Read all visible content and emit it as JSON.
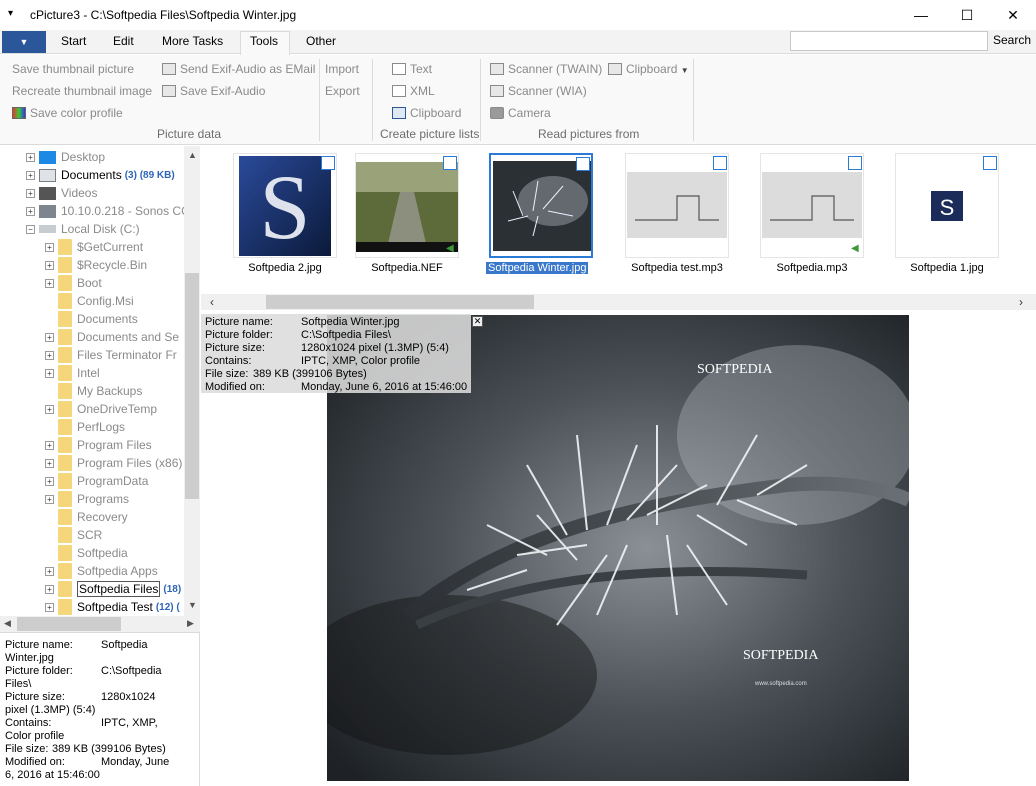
{
  "window": {
    "title": "cPicture3 - C:\\Softpedia Files\\Softpedia Winter.jpg",
    "quick_access": "▾",
    "minimize": "—",
    "maximize": "☐",
    "close": "✕"
  },
  "tabs": [
    "Start",
    "Edit",
    "More Tasks",
    "Tools",
    "Other"
  ],
  "active_tab": "Tools",
  "search": {
    "label": "Search",
    "value": ""
  },
  "ribbon": {
    "picture_data": {
      "label": "Picture data",
      "items": [
        "Save thumbnail picture",
        "Recreate thumbnail image",
        "Save color profile",
        "Send Exif-Audio as EMail",
        "Save Exif-Audio",
        "Import",
        "Export"
      ]
    },
    "create_lists": {
      "label": "Create picture lists",
      "items": [
        "Text",
        "XML",
        "Clipboard"
      ]
    },
    "read_from": {
      "label": "Read pictures from",
      "items": [
        "Scanner (TWAIN)",
        "Scanner (WIA)",
        "Camera",
        "Clipboard"
      ]
    }
  },
  "tree": [
    {
      "label": "Desktop",
      "type": "desktop",
      "exp": true,
      "grey": true
    },
    {
      "label": "Documents",
      "count": "(3) (89 KB)",
      "type": "docs",
      "exp": true
    },
    {
      "label": "Videos",
      "type": "video",
      "exp": true,
      "grey": true
    },
    {
      "label": "10.10.0.218 - Sonos CO",
      "type": "net",
      "exp": true,
      "grey": true
    },
    {
      "label": "Local Disk (C:)",
      "type": "disk",
      "exp": "open",
      "grey": true
    },
    {
      "label": "$GetCurrent",
      "exp": true,
      "grey": true,
      "child": true
    },
    {
      "label": "$Recycle.Bin",
      "exp": true,
      "grey": true,
      "child": true
    },
    {
      "label": "Boot",
      "exp": true,
      "grey": true,
      "child": true
    },
    {
      "label": "Config.Msi",
      "grey": true,
      "child": true
    },
    {
      "label": "Documents",
      "grey": true,
      "child": true
    },
    {
      "label": "Documents and Se",
      "exp": true,
      "grey": true,
      "child": true
    },
    {
      "label": "Files Terminator Fr",
      "exp": true,
      "grey": true,
      "child": true
    },
    {
      "label": "Intel",
      "exp": true,
      "grey": true,
      "child": true
    },
    {
      "label": "My Backups",
      "grey": true,
      "child": true
    },
    {
      "label": "OneDriveTemp",
      "exp": true,
      "grey": true,
      "child": true
    },
    {
      "label": "PerfLogs",
      "grey": true,
      "child": true
    },
    {
      "label": "Program Files",
      "exp": true,
      "grey": true,
      "child": true
    },
    {
      "label": "Program Files (x86)",
      "exp": true,
      "grey": true,
      "child": true
    },
    {
      "label": "ProgramData",
      "exp": true,
      "grey": true,
      "child": true
    },
    {
      "label": "Programs",
      "exp": true,
      "grey": true,
      "child": true
    },
    {
      "label": "Recovery",
      "grey": true,
      "child": true
    },
    {
      "label": "SCR",
      "grey": true,
      "child": true
    },
    {
      "label": "Softpedia",
      "grey": true,
      "child": true
    },
    {
      "label": "Softpedia Apps",
      "exp": true,
      "grey": true,
      "child": true
    },
    {
      "label": "Softpedia Files",
      "count": "(18) (",
      "exp": true,
      "child": true,
      "selected": true
    },
    {
      "label": "Softpedia Test",
      "count": "(12) (",
      "exp": true,
      "child": true
    }
  ],
  "thumbnails": [
    {
      "label": "Softpedia 2.jpg",
      "kind": "s-logo"
    },
    {
      "label": "Softpedia.NEF",
      "kind": "path",
      "audio": true
    },
    {
      "label": "Softpedia Winter.jpg",
      "kind": "winter",
      "selected": true
    },
    {
      "label": "Softpedia test.mp3",
      "kind": "wave"
    },
    {
      "label": "Softpedia.mp3",
      "kind": "wave",
      "audio": true
    },
    {
      "label": "Softpedia 1.jpg",
      "kind": "s-box"
    }
  ],
  "info": {
    "name_label": "Picture name:",
    "name": "Softpedia Winter.jpg",
    "folder_label": "Picture folder:",
    "folder": "C:\\Softpedia Files\\",
    "size_label": "Picture size:",
    "size": "1280x1024 pixel (1.3MP) (5:4)",
    "contains_label": "Contains:",
    "contains": "IPTC, XMP, Color profile",
    "filesize_label": "File size:",
    "filesize": "389 KB (399106 Bytes)",
    "modified_label": "Modified on:",
    "modified": "Monday, June 6, 2016 at 15:46:00"
  },
  "left_info_lines": {
    "name_a": "Softpedia",
    "name_b": "Winter.jpg",
    "folder_a": "C:\\Softpedia",
    "folder_b": "Files\\",
    "size_a": "1280x1024",
    "size_b": "pixel (1.3MP) (5:4)",
    "contains_a": "IPTC, XMP,",
    "contains_b": "Color profile",
    "filesize": "389 KB (399106 Bytes)",
    "modified_a": "Monday, June",
    "modified_b": "6, 2016 at 15:46:00"
  },
  "preview": {
    "watermark_top": "SOFTPEDIA",
    "watermark_bottom": "SOFTPEDIA",
    "url": "www.softpedia.com"
  },
  "colors": {
    "accent": "#2b579a",
    "selection": "#3877c9",
    "count": "#2e65b8"
  }
}
